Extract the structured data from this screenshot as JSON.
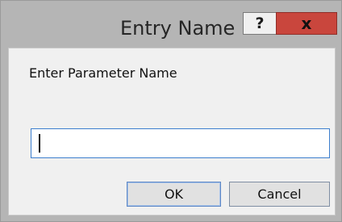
{
  "dialog": {
    "title": "Entry Name",
    "help_glyph": "?",
    "close_glyph": "x",
    "prompt": "Enter Parameter Name",
    "input": {
      "value": "",
      "placeholder": ""
    },
    "buttons": {
      "ok_label": "OK",
      "cancel_label": "Cancel"
    }
  },
  "colors": {
    "close_button": "#c9463d",
    "input_focus_border": "#3d7fce"
  }
}
